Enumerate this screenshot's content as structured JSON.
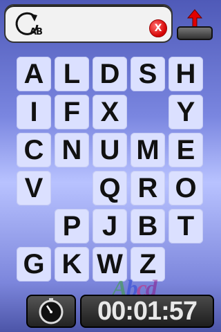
{
  "header": {
    "rotate_label": "AB",
    "clear_label": "X"
  },
  "board": {
    "rows": [
      [
        "A",
        "L",
        "D",
        "S",
        "H"
      ],
      [
        "I",
        "F",
        "X",
        "",
        "Y"
      ],
      [
        "C",
        "N",
        "U",
        "M",
        "E"
      ],
      [
        "V",
        "",
        "Q",
        "R",
        "O"
      ],
      [
        "",
        "P",
        "J",
        "B",
        "T"
      ],
      [
        "G",
        "K",
        "W",
        "Z",
        ""
      ]
    ]
  },
  "footer": {
    "timer": "00:01:57"
  },
  "logo": {
    "letters": [
      "A",
      "b",
      "c",
      "d"
    ]
  },
  "colors": {
    "clear_button": "#d40000",
    "submit_arrow": "#e00000",
    "tile_bg": "#dbe0ff"
  }
}
